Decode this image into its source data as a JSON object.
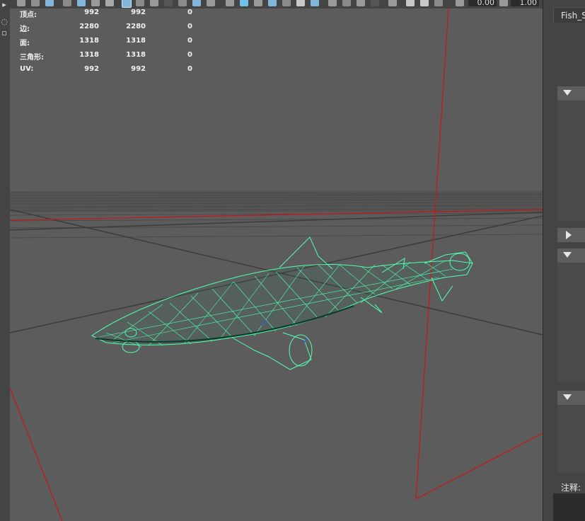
{
  "toolbar": {
    "field_1_value": "0.00",
    "field_2_value": "1.00"
  },
  "hud": {
    "rows": [
      {
        "label": "顶点:",
        "v1": "992",
        "v2": "992",
        "v3": "0"
      },
      {
        "label": "边:",
        "v1": "2280",
        "v2": "2280",
        "v3": "0"
      },
      {
        "label": "面:",
        "v1": "1318",
        "v2": "1318",
        "v3": "0"
      },
      {
        "label": "三角形:",
        "v1": "1318",
        "v2": "1318",
        "v3": "0"
      },
      {
        "label": "UV:",
        "v1": "992",
        "v2": "992",
        "v3": "0"
      }
    ]
  },
  "right_panel": {
    "tab_label": "Fish_S",
    "notes_label": "注释:"
  },
  "colors": {
    "viewport_bg": "#5c5c5c",
    "wireframe": "#4fffb0",
    "axis_red": "#c21a1a",
    "grid_dark": "#3b3b3b"
  }
}
